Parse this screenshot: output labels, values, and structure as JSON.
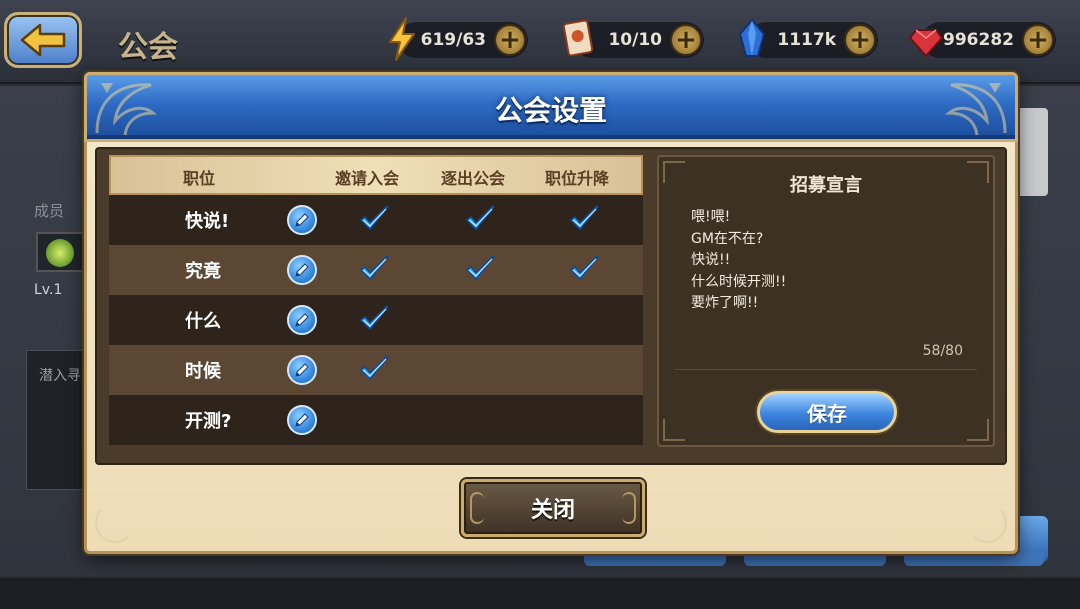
{
  "screen": {
    "title": "公会"
  },
  "resources": {
    "energy": {
      "value": "619/63",
      "icon": "lightning-icon"
    },
    "ticket": {
      "value": "10/10",
      "icon": "ticket-icon"
    },
    "crystal": {
      "value": "1117k",
      "icon": "crystal-icon"
    },
    "gem": {
      "value": "996282",
      "icon": "ruby-icon"
    }
  },
  "background": {
    "members_label": "成员",
    "level_label": "Lv.1",
    "box_label": "潜入寻"
  },
  "dialog": {
    "title": "公会设置",
    "table": {
      "headers": {
        "role": "职位",
        "invite": "邀请入会",
        "kick": "逐出公会",
        "promote": "职位升降"
      },
      "rows": [
        {
          "role": "快说!",
          "invite": true,
          "kick": true,
          "promote": true
        },
        {
          "role": "究竟",
          "invite": true,
          "kick": true,
          "promote": true
        },
        {
          "role": "什么",
          "invite": true,
          "kick": false,
          "promote": false
        },
        {
          "role": "时候",
          "invite": true,
          "kick": false,
          "promote": false
        },
        {
          "role": "开测?",
          "invite": false,
          "kick": false,
          "promote": false
        }
      ]
    },
    "recruit": {
      "title": "招募宣言",
      "lines": [
        "喂!喂!",
        "GM在不在?",
        "快说!!",
        "什么时候开测!!",
        "要炸了啊!!"
      ],
      "count": "58/80",
      "save_label": "保存"
    },
    "close_label": "关闭"
  },
  "colors": {
    "header_blue": "#2e6bc4",
    "frame_brown": "#4a3b2b",
    "check_blue": "#3aa7ff",
    "gold_border": "#c9ad72"
  }
}
